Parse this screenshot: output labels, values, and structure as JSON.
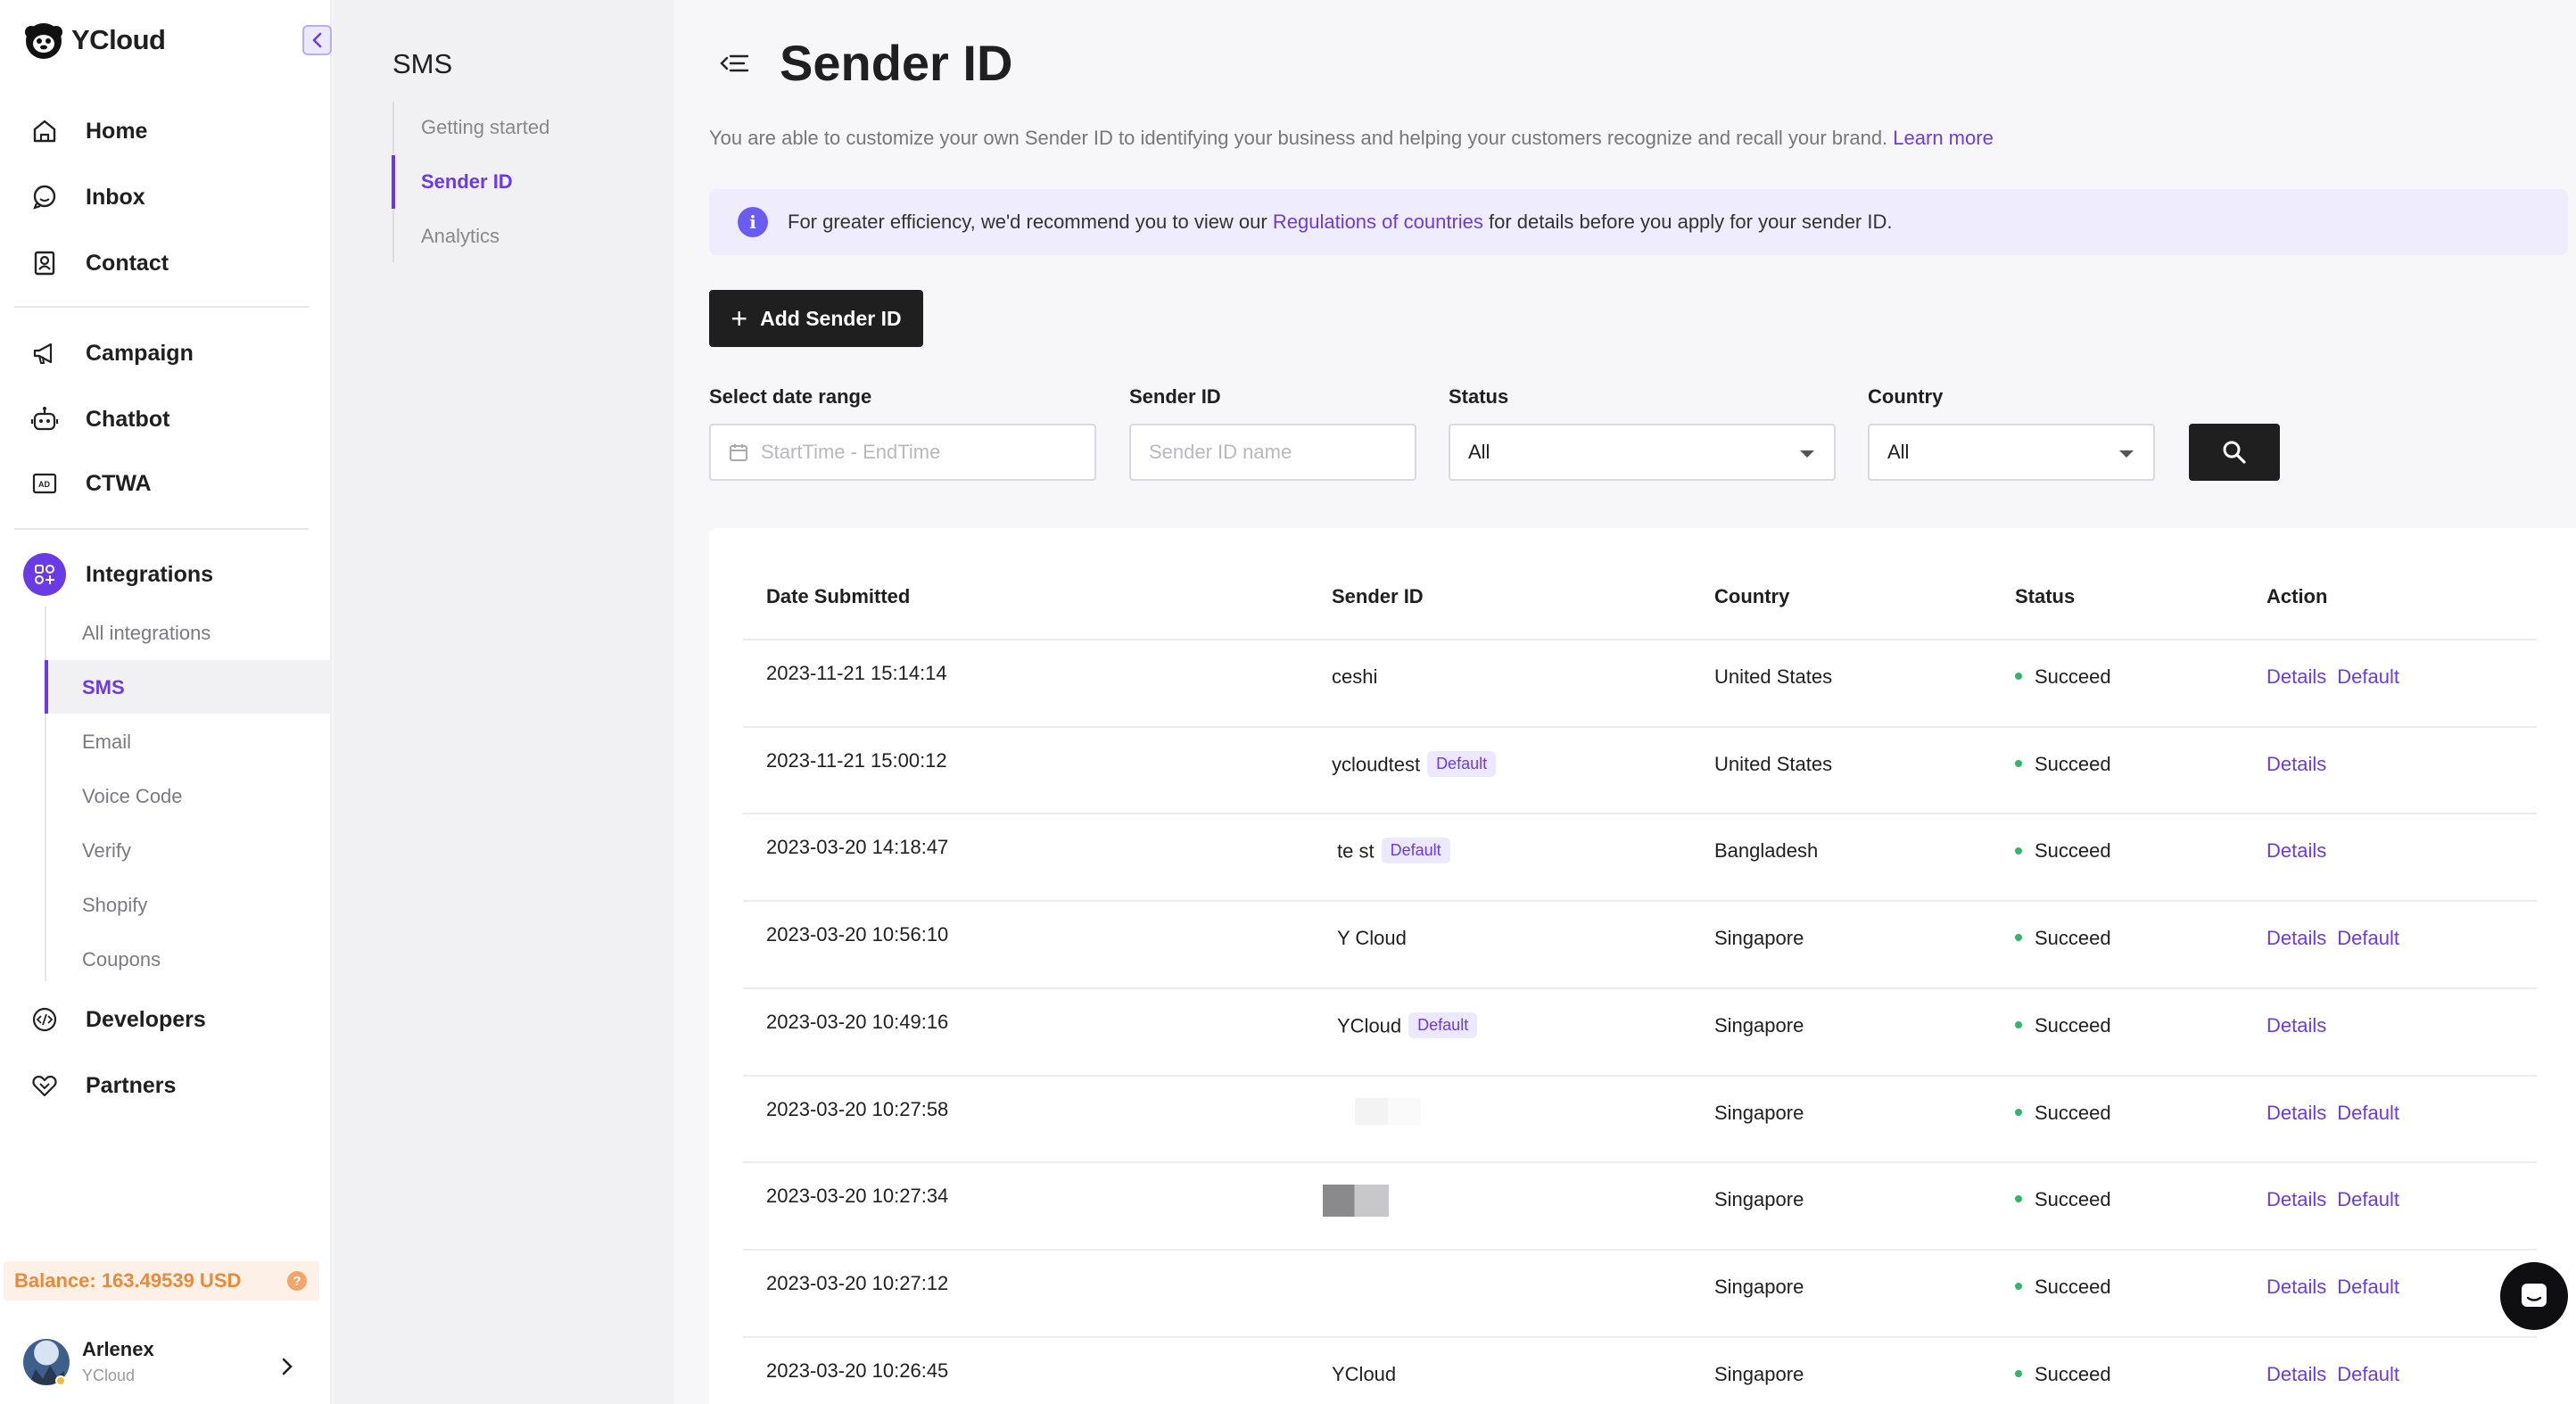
{
  "brand": {
    "name": "YCloud",
    "accent": "#6a3be4"
  },
  "nav": {
    "items": [
      {
        "label": "Home",
        "icon": "home-icon"
      },
      {
        "label": "Inbox",
        "icon": "chat-bubble-icon"
      },
      {
        "label": "Contact",
        "icon": "contact-card-icon"
      },
      {
        "label": "Campaign",
        "icon": "megaphone-icon"
      },
      {
        "label": "Chatbot",
        "icon": "robot-icon"
      },
      {
        "label": "CTWA",
        "icon": "ad-icon"
      },
      {
        "label": "Integrations",
        "icon": "integrations-icon"
      },
      {
        "label": "Developers",
        "icon": "code-icon"
      },
      {
        "label": "Partners",
        "icon": "handshake-icon"
      }
    ],
    "integration_subitems": [
      "All integrations",
      "SMS",
      "Email",
      "Voice Code",
      "Verify",
      "Shopify",
      "Coupons"
    ],
    "active_subitem": "SMS"
  },
  "balance": {
    "text": "Balance: 163.49539 USD"
  },
  "user": {
    "name": "Arlenex",
    "org": "YCloud"
  },
  "sms_menu": {
    "title": "SMS",
    "items": [
      "Getting started",
      "Sender ID",
      "Analytics"
    ],
    "active": "Sender ID"
  },
  "page": {
    "title": "Sender ID",
    "description": "You are able to customize your own Sender ID to identifying your business and helping your customers recognize and recall your brand.",
    "learn_more": "Learn more",
    "notice_prefix": "For greater efficiency, we'd recommend you to view our",
    "notice_link": "Regulations of countries",
    "notice_suffix": "for details before you apply for your sender ID.",
    "add_button": "Add Sender ID"
  },
  "filters": {
    "date": {
      "label": "Select date range",
      "placeholder": "StartTime - EndTime"
    },
    "sender": {
      "label": "Sender ID",
      "placeholder": "Sender ID name"
    },
    "status": {
      "label": "Status",
      "value": "All"
    },
    "country": {
      "label": "Country",
      "value": "All"
    }
  },
  "table": {
    "columns": [
      "Date Submitted",
      "Sender ID",
      "Country",
      "Status",
      "Action"
    ],
    "rows": [
      {
        "date": "2023-11-21 15:14:14",
        "sender": "ceshi",
        "default_badge": "",
        "country": "United States",
        "status": "Succeed",
        "actions": [
          "Details",
          "Default"
        ]
      },
      {
        "date": "2023-11-21 15:00:12",
        "sender": "ycloudtest",
        "default_badge": "Default",
        "country": "United States",
        "status": "Succeed",
        "actions": [
          "Details"
        ]
      },
      {
        "date": "2023-03-20 14:18:47",
        "sender": "te st",
        "default_badge": "Default",
        "country": "Bangladesh",
        "status": "Succeed",
        "actions": [
          "Details"
        ]
      },
      {
        "date": "2023-03-20 10:56:10",
        "sender": "Y Cloud",
        "default_badge": "",
        "country": "Singapore",
        "status": "Succeed",
        "actions": [
          "Details",
          "Default"
        ]
      },
      {
        "date": "2023-03-20 10:49:16",
        "sender": "YCloud",
        "default_badge": "Default",
        "country": "Singapore",
        "status": "Succeed",
        "actions": [
          "Details"
        ]
      },
      {
        "date": "2023-03-20 10:27:58",
        "sender": "",
        "default_badge": "",
        "country": "Singapore",
        "status": "Succeed",
        "actions": [
          "Details",
          "Default"
        ]
      },
      {
        "date": "2023-03-20 10:27:34",
        "sender": "",
        "default_badge": "",
        "country": "Singapore",
        "status": "Succeed",
        "actions": [
          "Details",
          "Default"
        ]
      },
      {
        "date": "2023-03-20 10:27:12",
        "sender": "",
        "default_badge": "",
        "country": "Singapore",
        "status": "Succeed",
        "actions": [
          "Details",
          "Default"
        ]
      },
      {
        "date": "2023-03-20 10:26:45",
        "sender": "YCloud",
        "default_badge": "",
        "country": "Singapore",
        "status": "Succeed",
        "actions": [
          "Details",
          "Default"
        ]
      }
    ]
  }
}
